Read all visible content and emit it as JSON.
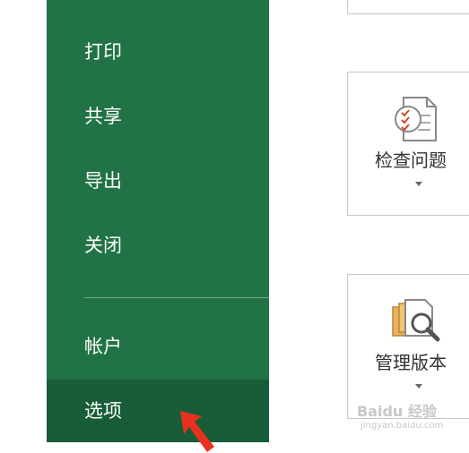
{
  "nav": {
    "items": [
      {
        "label": "打印"
      },
      {
        "label": "共享"
      },
      {
        "label": "导出"
      },
      {
        "label": "关闭"
      },
      {
        "label": "帐户"
      },
      {
        "label": "选项",
        "selected": true
      }
    ]
  },
  "pane": {
    "inspect": {
      "label": "检查问题",
      "icon": "inspect-document-icon"
    },
    "versions": {
      "label": "管理版本",
      "icon": "manage-versions-icon"
    }
  },
  "watermark": {
    "text": "Baidu 经验",
    "sub": "jingyan.baidu.com"
  },
  "colors": {
    "sidebar": "#217346",
    "selected": "#185d37",
    "arrow": "#e8321f"
  }
}
